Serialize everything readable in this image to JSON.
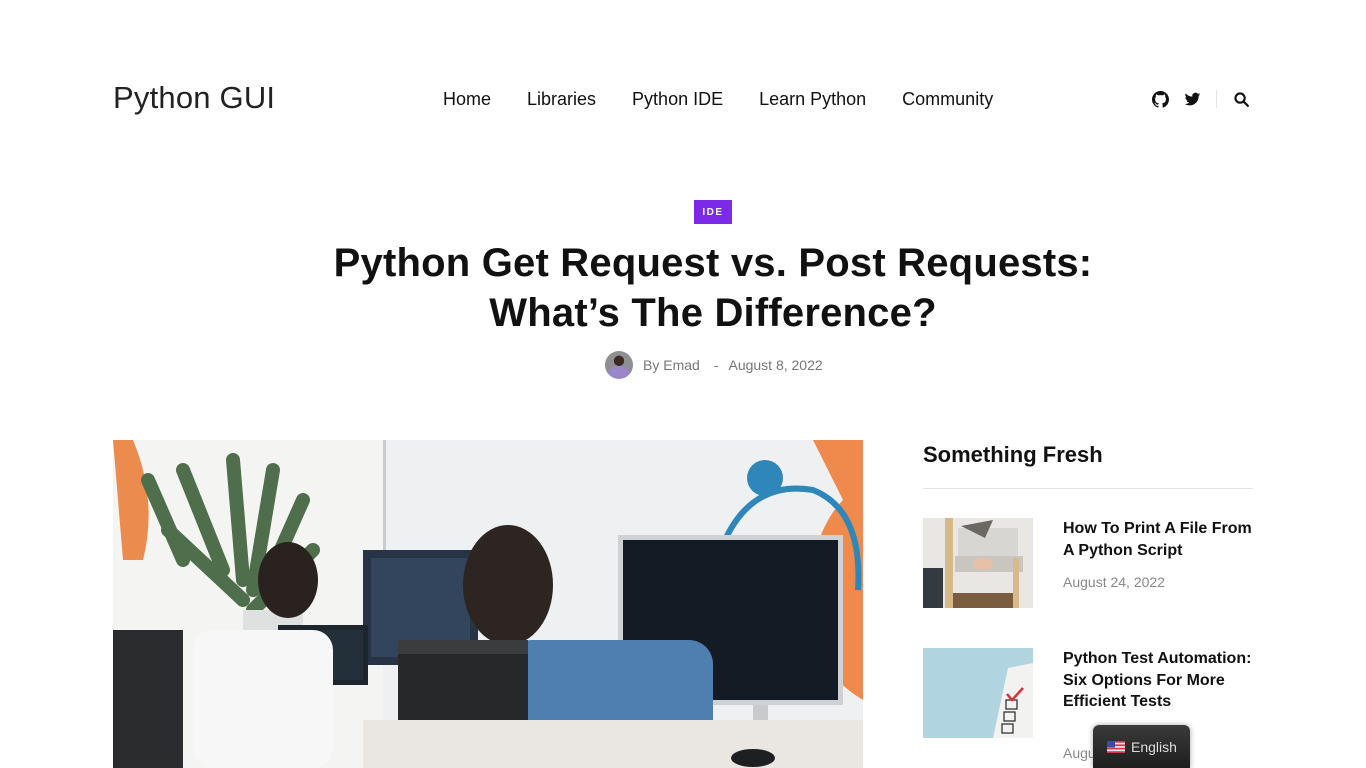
{
  "site": {
    "logo": "Python GUI"
  },
  "nav": {
    "items": [
      {
        "label": "Home"
      },
      {
        "label": "Libraries"
      },
      {
        "label": "Python IDE"
      },
      {
        "label": "Learn Python"
      },
      {
        "label": "Community"
      }
    ]
  },
  "header_icons": [
    "github-icon",
    "twitter-icon",
    "search-icon"
  ],
  "article": {
    "category": "IDE",
    "category_color": "#7c2ae8",
    "title_line1": "Python Get Request vs. Post Requests:",
    "title_line2": "What’s The Difference?",
    "author": "By Emad",
    "separator": "-",
    "date": "August 8, 2022",
    "hero_image": "two-developers-at-computers"
  },
  "sidebar": {
    "heading": "Something Fresh",
    "posts": [
      {
        "title": "How To Print A File From A Python Script",
        "date": "August 24, 2022",
        "thumb": "printer-photo"
      },
      {
        "title": "Python Test Automation: Six Options For More Efficient Tests",
        "date": "August",
        "thumb": "checklist-photo"
      }
    ]
  },
  "language_switcher": {
    "label": "English",
    "flag": "us-flag-icon"
  }
}
